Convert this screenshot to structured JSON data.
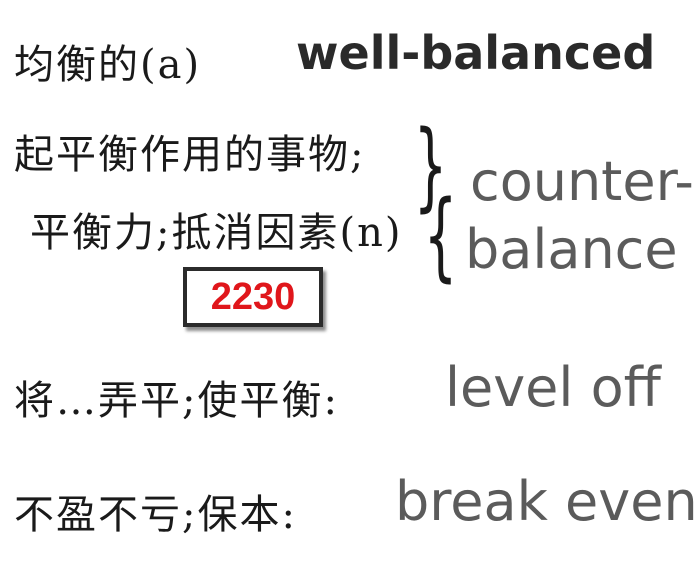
{
  "lines": [
    {
      "cn": "均衡的(a)",
      "en": "well-balanced"
    },
    {
      "cn": "起平衡作用的事物;"
    },
    {
      "cn": "平衡力;抵消因素(n)"
    },
    {
      "en": "counter-"
    },
    {
      "en": "balance"
    },
    {
      "cn": "将…弄平;使平衡:",
      "en": "level off"
    },
    {
      "cn": "不盈不亏;保本:",
      "en": "break even"
    }
  ],
  "brace_left": "{",
  "brace_right": "}",
  "badge": {
    "number": "2230",
    "number_color": "#e0161b"
  }
}
